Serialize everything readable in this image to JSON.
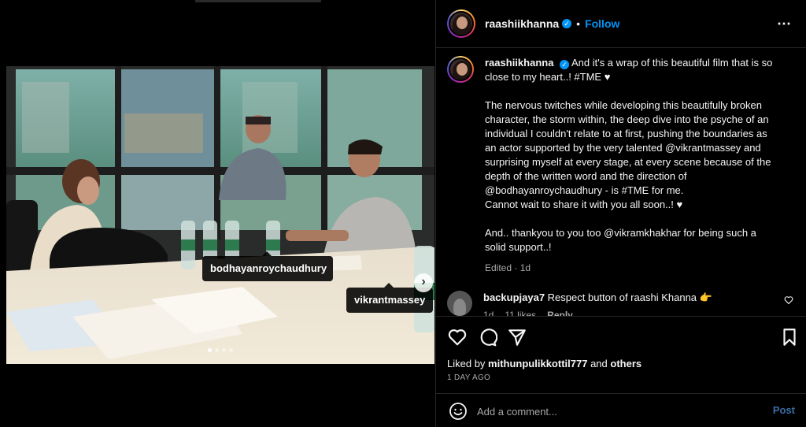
{
  "post": {
    "username": "raashiikhanna",
    "follow_label": "Follow",
    "separator": "•",
    "more_icon": "⋯"
  },
  "media": {
    "tags": [
      "bodhayanroychaudhury",
      "vikrantmassey"
    ],
    "next_icon": "›",
    "carousel": {
      "total": 4,
      "current": 1
    }
  },
  "caption": {
    "username": "raashiikhanna",
    "paragraphs": [
      "And it's a wrap of this beautiful film that is so close to my heart..! #TME ♥",
      "The nervous twitches while developing this beautifully broken character, the storm within, the deep dive into the psyche of an individual I couldn't relate to at first, pushing the boundaries as an actor supported by the very talented @vikrantmassey and surprising myself at every stage, at every scene because of the depth of the written word and the direction of @bodhayanroychaudhury - is #TME for me.",
      "Cannot wait to share it with you all soon..! ♥",
      "And.. thankyou to you too @vikramkhakhar for being such a solid support..!"
    ],
    "meta": "Edited · 1d"
  },
  "comments": [
    {
      "username": "backupjaya7",
      "text": "Respect button of raashi Khanna 👉",
      "time": "1d",
      "likes": "11 likes",
      "reply": "Reply"
    }
  ],
  "engagement": {
    "liked_by_prefix": "Liked by",
    "liked_by_user": "mithunpulikkottil777",
    "liked_by_and": "and",
    "liked_by_others": "others",
    "date": "1 DAY AGO"
  },
  "compose": {
    "placeholder": "Add a comment...",
    "post_label": "Post"
  },
  "colors": {
    "accent": "#0095f6",
    "post_disabled": "#3a6ea5",
    "muted": "#a8a8a8",
    "border": "#262626"
  }
}
